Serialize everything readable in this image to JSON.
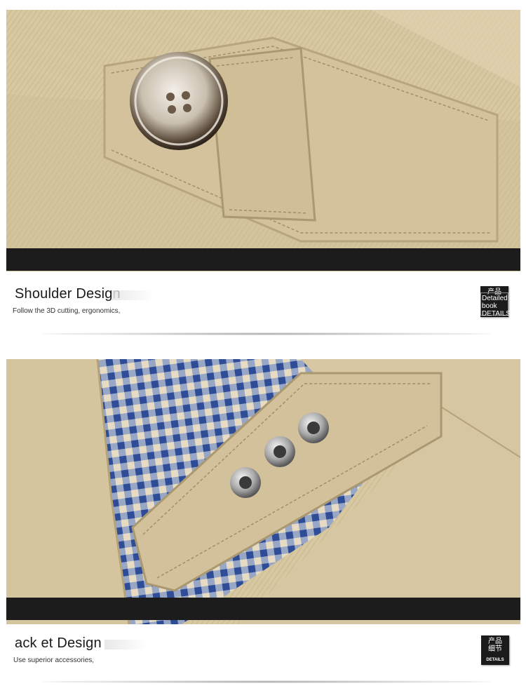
{
  "sections": [
    {
      "title": "Shoulder Design",
      "subtitle": "Follow the 3D cutting, ergonomics,",
      "badge": {
        "chinese_top": "产品",
        "overlay_text": "Detailed book DETAILS"
      }
    },
    {
      "title": "ack et Design",
      "subtitle": "Use superior accessories,",
      "badge": {
        "chinese_top": "产品",
        "chinese_bottom": "细节",
        "english": "DETAILS"
      }
    }
  ],
  "colors": {
    "fabric": "#d9c9a5",
    "fabric_shadow": "#bfae87",
    "band": "#1c1c1c",
    "check_blue": "#3f5fa8",
    "check_light": "#e7dcc3"
  }
}
